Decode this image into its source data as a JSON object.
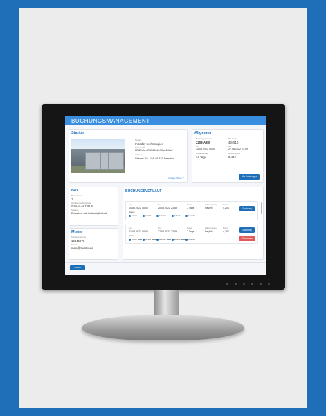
{
  "app": {
    "title": "BUCHUNGSMANAGEMENT"
  },
  "station": {
    "title": "Station",
    "name_label": "Name",
    "name": "Intraday technologies",
    "id_label": "Stations-ID",
    "id": "22422dfe-4232-24344Sffsd-24fsdf",
    "address_label": "Adresse",
    "address": "Wiener Str. 114, 01219 Dresden",
    "map_link": "In Maps öffnen ↗"
  },
  "general": {
    "title": "Allgemein",
    "booking_number_label": "Buchungsnummer",
    "booking_number": "2208-A8IX",
    "pin_label": "Pin Code",
    "pin": "434910",
    "from_label": "von",
    "from": "14.08.2022 00:00",
    "to_label": "bis",
    "to": "27.08.2022 23:59",
    "duration_label": "Gesamtdauer",
    "duration": "14 Tage",
    "price_label": "Gesamtpreis",
    "price": "8,40€",
    "all_bookings_button": "Alle Buchungen"
  },
  "box": {
    "title": "Box",
    "number_label": "Boxnummer",
    "number": "1",
    "hardware_label": "Hardwareschnittstelle",
    "hardware": "WT0-04.41   Port #0",
    "storage_label": "Storage",
    "storage": "Einzelbox mit Lademöglichkeit"
  },
  "tenant": {
    "title": "Mieter",
    "customer_label": "Kundennummer",
    "customer": "12345678",
    "email_label": "Email",
    "email": "max@muster.de"
  },
  "history": {
    "title": "BUCHUNGSVERLAUF",
    "col_from": "von",
    "col_to": "bis",
    "col_duration": "Dauer",
    "col_payment": "Zahlungsweg",
    "col_price": "Preis",
    "status_label": "Status",
    "steps": [
      "erstellt",
      "bezahlt",
      "bestätigt",
      "laufend",
      "beendet"
    ],
    "bookings": [
      {
        "from": "14.08.2022 00:00",
        "to": "20.08.2022 23:59",
        "duration": "7 Tage",
        "payment": "PayPal",
        "price": "4,20€",
        "button": "Buchung"
      },
      {
        "from": "21.08.2022 00:00",
        "to": "27.08.2022 23:59",
        "duration": "7 Tage",
        "payment": "PayPal",
        "price": "4,20€",
        "button": "Buchung",
        "button2": "Stornieren"
      }
    ]
  },
  "footer": {
    "back_button": "zurück"
  },
  "colors": {
    "primary": "#1f6fb8",
    "header": "#3a8ee0",
    "danger": "#e25b5b",
    "background": "#1f6fb8"
  }
}
